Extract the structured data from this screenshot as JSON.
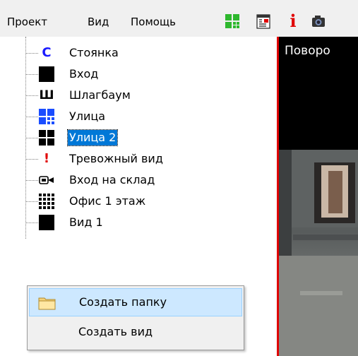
{
  "menu": {
    "project": "Проект",
    "view": "Вид",
    "help": "Помощь"
  },
  "toolbar": {
    "icons": [
      "grid-layout-icon",
      "calendar-icon",
      "info-icon",
      "camera-icon"
    ],
    "info_glyph": "i",
    "colors": {
      "grid": "#2eb82e",
      "info": "#e00000",
      "calendar_accent": "#e00000"
    }
  },
  "tree": {
    "items": [
      {
        "label": "Стоянка",
        "icon": "letter-c-icon",
        "glyph": "C",
        "color": "#1a1aff"
      },
      {
        "label": "Вход",
        "icon": "black-square-icon"
      },
      {
        "label": "Шлагбаум",
        "icon": "letter-sh-icon",
        "glyph": "Ш"
      },
      {
        "label": "Улица",
        "icon": "blue-grid-icon",
        "color": "#1a4dff"
      },
      {
        "label": "Улица 2",
        "icon": "black-grid-icon",
        "selected": true
      },
      {
        "label": "Тревожный вид",
        "icon": "exclamation-icon",
        "glyph": "!",
        "color": "#e00000"
      },
      {
        "label": "Вход на склад",
        "icon": "camera-icon"
      },
      {
        "label": "Офис 1 этаж",
        "icon": "dense-grid-icon"
      },
      {
        "label": "Вид 1",
        "icon": "black-square-icon"
      }
    ]
  },
  "context_menu": {
    "items": [
      {
        "label": "Создать папку",
        "icon": "folder-icon",
        "hover": true
      },
      {
        "label": "Создать вид",
        "icon": ""
      }
    ]
  },
  "video": {
    "title": "Поворо",
    "border_color": "#e00000"
  }
}
